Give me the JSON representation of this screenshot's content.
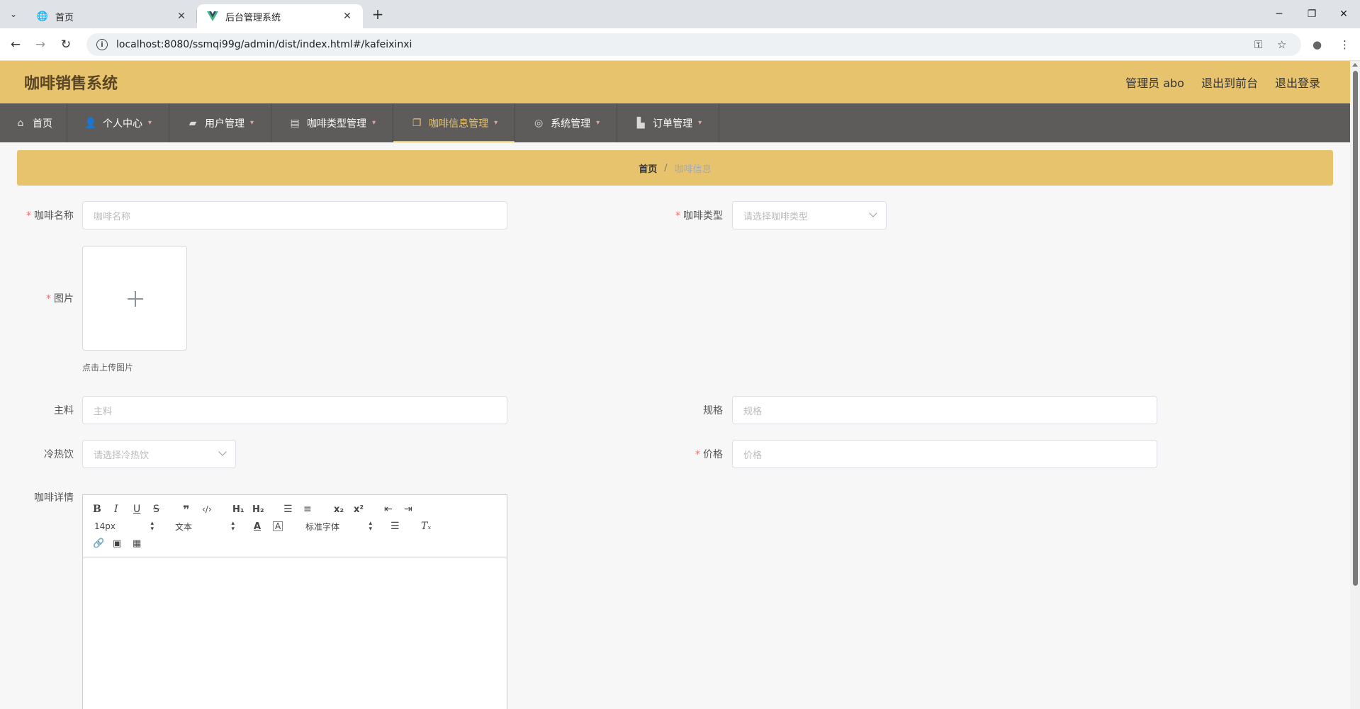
{
  "browser": {
    "tabs": [
      {
        "title": "首页",
        "favicon": "globe-icon"
      },
      {
        "title": "后台管理系统",
        "favicon": "vue-logo-icon"
      }
    ],
    "url": "localhost:8080/ssmqi99g/admin/dist/index.html#/kafeixinxi"
  },
  "header": {
    "title": "咖啡销售系统",
    "admin_label": "管理员 abo",
    "front_link": "退出到前台",
    "logout_link": "退出登录"
  },
  "menu": {
    "items": [
      {
        "label": "首页",
        "icon": "home-icon"
      },
      {
        "label": "个人中心",
        "icon": "user-icon"
      },
      {
        "label": "用户管理",
        "icon": "user-manage-icon"
      },
      {
        "label": "咖啡类型管理",
        "icon": "briefcase-icon"
      },
      {
        "label": "咖啡信息管理",
        "icon": "copy-icon"
      },
      {
        "label": "系统管理",
        "icon": "settings-icon"
      },
      {
        "label": "订单管理",
        "icon": "order-icon"
      }
    ],
    "active_color": "#e8c36e"
  },
  "breadcrumb": {
    "home": "首页",
    "separator": "/",
    "current": "咖啡信息"
  },
  "form": {
    "name": {
      "label": "咖啡名称",
      "placeholder": "咖啡名称"
    },
    "type": {
      "label": "咖啡类型",
      "placeholder": "请选择咖啡类型"
    },
    "image": {
      "label": "图片",
      "tip": "点击上传图片"
    },
    "ingredient": {
      "label": "主料",
      "placeholder": "主料"
    },
    "spec": {
      "label": "规格",
      "placeholder": "规格"
    },
    "temperature": {
      "label": "冷热饮",
      "placeholder": "请选择冷热饮"
    },
    "price": {
      "label": "价格",
      "placeholder": "价格"
    },
    "detail": {
      "label": "咖啡详情"
    }
  },
  "editor": {
    "font_size": "14px",
    "header_mode": "文本",
    "font_family": "标准字体"
  },
  "colors": {
    "brand": "#e8c36e",
    "menu_bg": "#5d5c5b",
    "required": "#f56c6c"
  }
}
